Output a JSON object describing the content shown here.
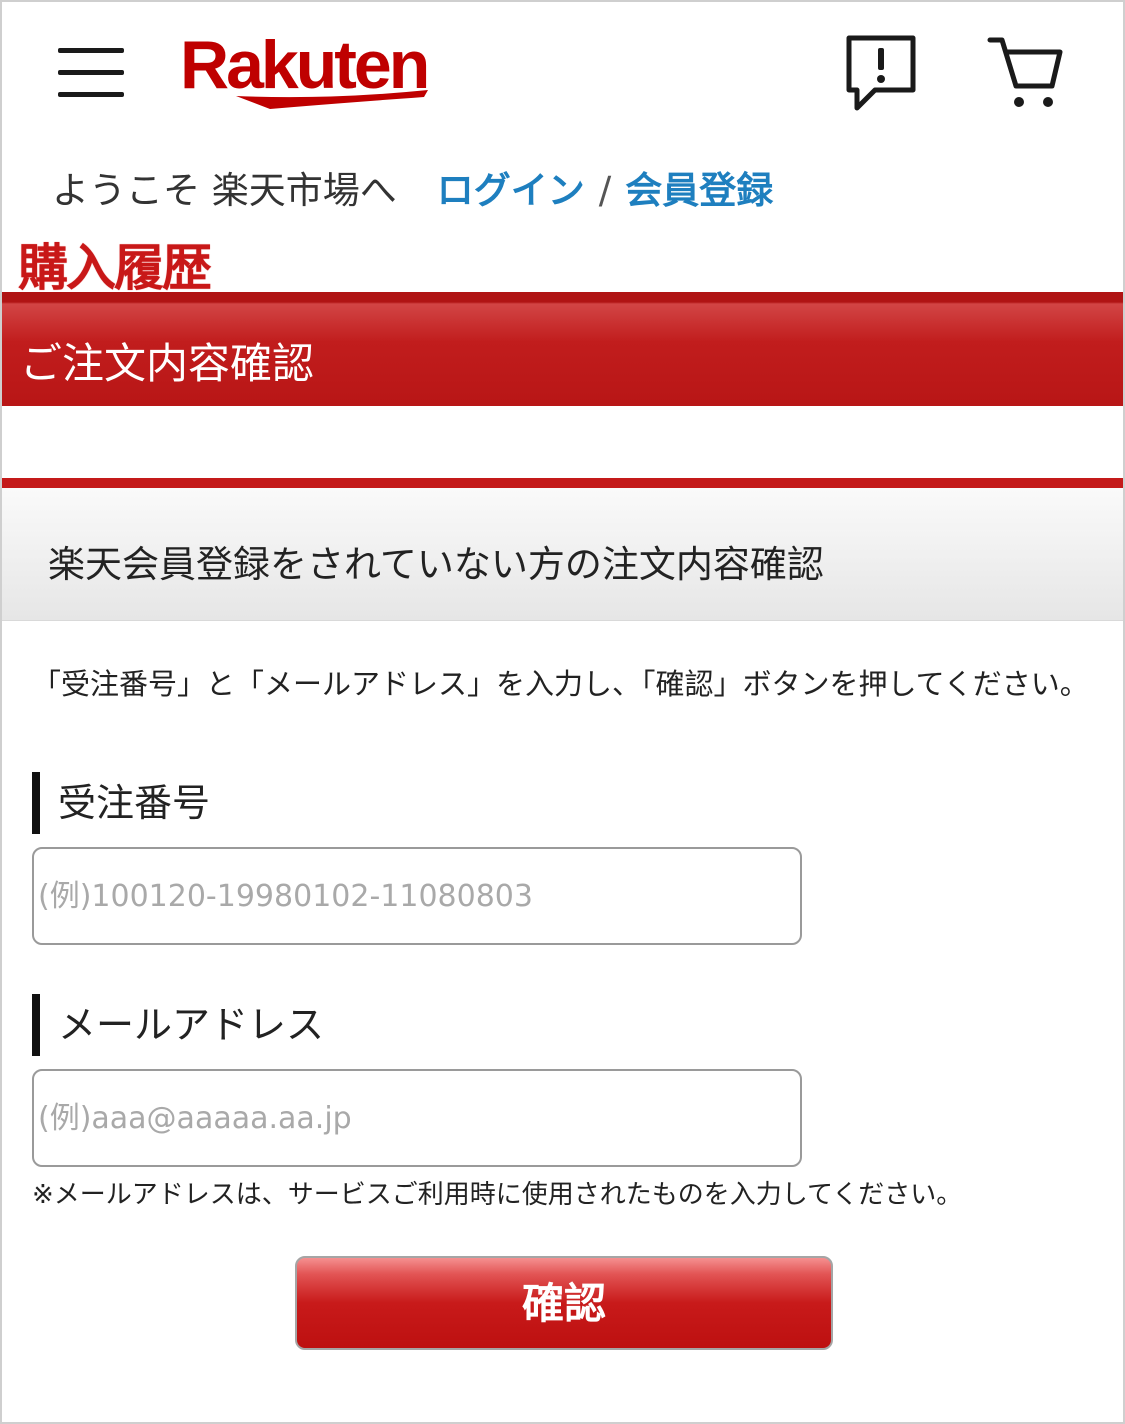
{
  "header": {
    "logo_text": "Rakuten",
    "menu_icon": "hamburger-menu-icon",
    "notice_icon": "notice-bubble-icon",
    "cart_icon": "shopping-cart-icon",
    "brand_color": "#bf0000"
  },
  "welcome": {
    "text": "ようこそ 楽天市場へ",
    "login_label": "ログイン",
    "separator": "/",
    "register_label": "会員登録",
    "link_color": "#1e7fbf"
  },
  "page": {
    "history_title": "購入履歴",
    "section_title": "ご注文内容確認",
    "subsection_title": "楽天会員登録をされていない方の注文内容確認",
    "instruction": "「受注番号」と「メールアドレス」を入力し、「確認」ボタンを押してください。"
  },
  "form": {
    "order_number": {
      "label": "受注番号",
      "value": "",
      "placeholder": "(例)100120-19980102-11080803"
    },
    "email": {
      "label": "メールアドレス",
      "value": "",
      "placeholder": "(例)aaa@aaaaa.aa.jp"
    },
    "note": "※メールアドレスは、サービスご利用時に使用されたものを入力してください。",
    "submit_label": "確認"
  },
  "colors": {
    "accent_red": "#c41a1a"
  }
}
